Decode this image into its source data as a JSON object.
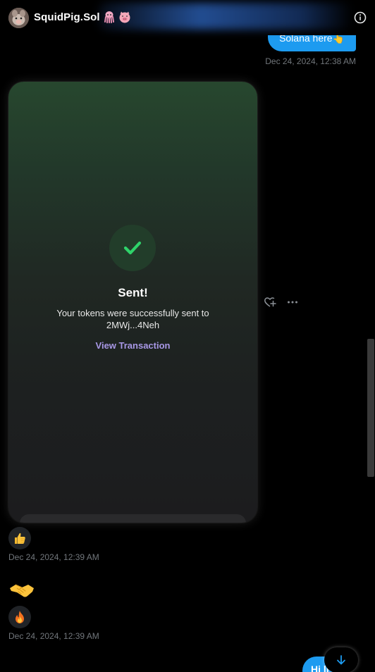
{
  "header": {
    "name": "SquidPig.Sol",
    "name_emojis": [
      "squid-emoji",
      "pig-face-emoji"
    ],
    "info_icon": "info-circle-icon"
  },
  "messages": {
    "top_outgoing": {
      "text": "Solana here👆",
      "timestamp": "Dec 24, 2024, 12:38 AM"
    },
    "transaction_card": {
      "status_icon": "check-icon",
      "title": "Sent!",
      "description_line1": "Your tokens were successfully sent to",
      "description_line2": "2MWj...4Neh",
      "link_label": "View Transaction",
      "actions": [
        "add-reaction-icon",
        "more-options-icon"
      ]
    },
    "reaction_group_1": {
      "emoji": "thumbs-up-emoji",
      "timestamp": "Dec 24, 2024, 12:39 AM"
    },
    "reaction_group_2": {
      "emojis": [
        "handshake-emoji",
        "fire-emoji"
      ],
      "timestamp": "Dec 24, 2024, 12:39 AM"
    },
    "bottom_outgoing": {
      "text": "Hi li"
    }
  },
  "scroll_down_button": "arrow-down-icon",
  "colors": {
    "accent_blue": "#1d9bf0",
    "success_green": "#2fd36a",
    "link_purple": "#a898e6",
    "timestamp_gray": "#71767b"
  }
}
